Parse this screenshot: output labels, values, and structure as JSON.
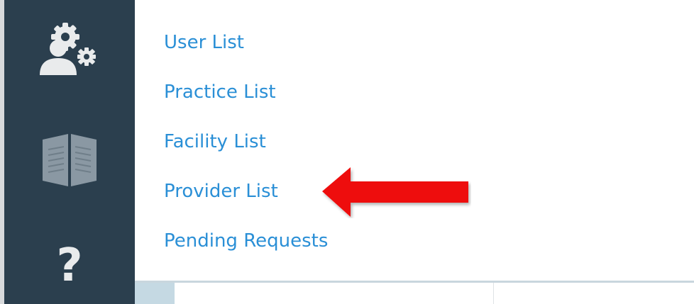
{
  "sidebar": {
    "icons": [
      {
        "name": "admin-settings-icon"
      },
      {
        "name": "book-icon"
      },
      {
        "name": "help-icon",
        "glyph": "?"
      }
    ],
    "color": "#2b3f4e"
  },
  "menu": {
    "items": [
      {
        "label": "User List"
      },
      {
        "label": "Practice List"
      },
      {
        "label": "Facility List"
      },
      {
        "label": "Provider List"
      },
      {
        "label": "Pending Requests"
      }
    ],
    "link_color": "#2a8fd6"
  },
  "annotation": {
    "arrow_color": "#ee1111",
    "points_to": "Provider List"
  }
}
